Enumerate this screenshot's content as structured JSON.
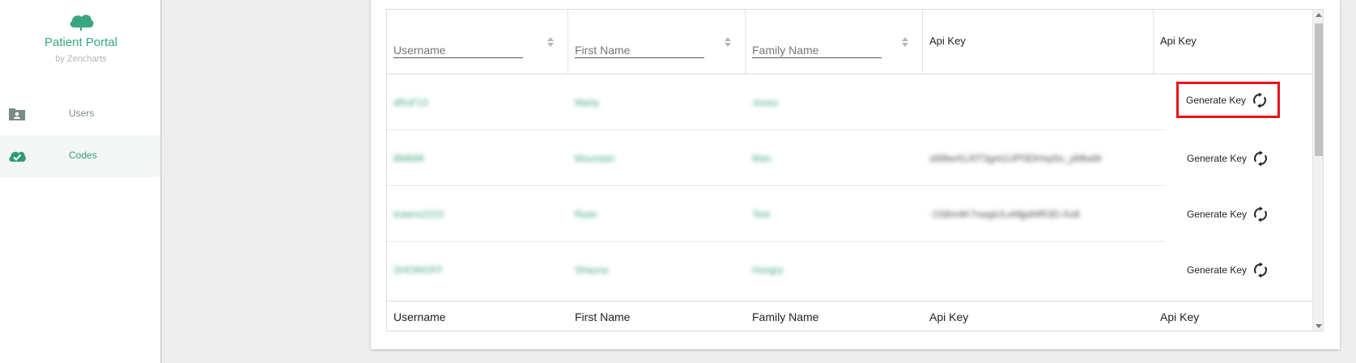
{
  "sidebar": {
    "brand": {
      "title": "Patient Portal",
      "subtitle": "by Zencharts"
    },
    "items": [
      {
        "label": "Users",
        "icon": "folder-user-icon",
        "active": false
      },
      {
        "label": "Codes",
        "icon": "cloud-check-icon",
        "active": true
      }
    ]
  },
  "table": {
    "headers": {
      "username_placeholder": "Username",
      "first_name_placeholder": "First Name",
      "family_name_placeholder": "Family Name",
      "api_key": "Api Key",
      "api_key_action": "Api Key"
    },
    "rows": [
      {
        "username": "dRoF13",
        "first_name": "Marty",
        "family_name": "Jones",
        "api_key": "",
        "action_label": "Generate Key"
      },
      {
        "username": "BM696",
        "first_name": "Mountain",
        "family_name": "Man",
        "api_key": "s69be41J0T3gnt1UPf3DHnp5n_yMba9r",
        "action_label": "Generate Key"
      },
      {
        "username": "trawns2222",
        "first_name": "Ryan",
        "family_name": "Test",
        "api_key": "-1S8m4K7nwgiULeMjjdAfR3D-Xo6",
        "action_label": "Generate Key"
      },
      {
        "username": "SHOWOFF",
        "first_name": "Shauna",
        "family_name": "Hungry",
        "api_key": "",
        "action_label": "Generate Key"
      }
    ],
    "footer": {
      "username": "Username",
      "first_name": "First Name",
      "family_name": "Family Name",
      "api_key": "Api Key",
      "api_key_action": "Api Key"
    }
  },
  "colors": {
    "brand": "#3aa680",
    "highlight": "#e8141a"
  }
}
